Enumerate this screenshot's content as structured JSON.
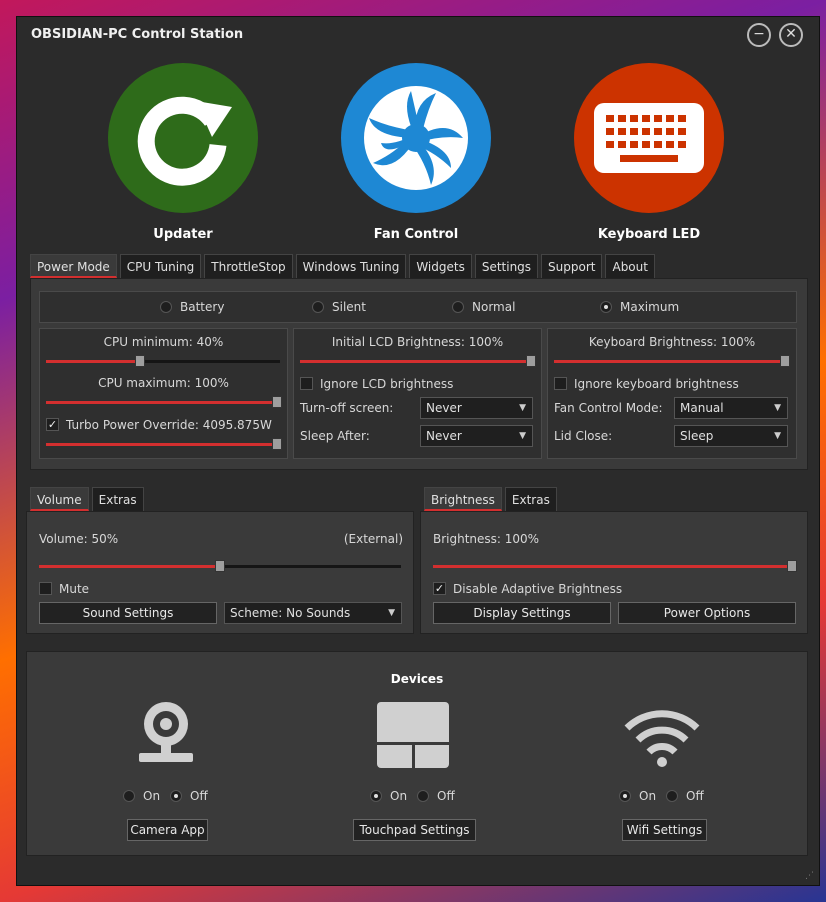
{
  "window": {
    "title": "OBSIDIAN-PC Control Station",
    "minimize": "−",
    "close": "✕"
  },
  "apps": [
    {
      "label": "Updater",
      "icon": "refresh-icon",
      "color": "#2e6b1a"
    },
    {
      "label": "Fan Control",
      "icon": "fan-icon",
      "color": "#1e88d4"
    },
    {
      "label": "Keyboard LED",
      "icon": "keyboard-icon",
      "color": "#cc3300"
    }
  ],
  "main_tabs": [
    "Power Mode",
    "CPU Tuning",
    "ThrottleStop",
    "Windows Tuning",
    "Widgets",
    "Settings",
    "Support",
    "About"
  ],
  "power_modes": [
    {
      "label": "Battery",
      "selected": false
    },
    {
      "label": "Silent",
      "selected": false
    },
    {
      "label": "Normal",
      "selected": false
    },
    {
      "label": "Maximum",
      "selected": true
    }
  ],
  "cpu": {
    "min_label": "CPU minimum: 40%",
    "min_value": 40,
    "max_label": "CPU maximum: 100%",
    "max_value": 100,
    "turbo_label": "Turbo Power Override: 4095.875W",
    "turbo_checked": true,
    "turbo_value": 100
  },
  "lcd": {
    "label": "Initial LCD Brightness: 100%",
    "value": 100,
    "ignore_label": "Ignore LCD brightness",
    "ignore_checked": false,
    "turnoff_label": "Turn-off screen:",
    "turnoff_value": "Never",
    "sleep_label": "Sleep After:",
    "sleep_value": "Never"
  },
  "keyboard": {
    "label": "Keyboard Brightness: 100%",
    "value": 100,
    "ignore_label": "Ignore keyboard brightness",
    "ignore_checked": false,
    "fan_label": "Fan Control Mode:",
    "fan_value": "Manual",
    "lid_label": "Lid Close:",
    "lid_value": "Sleep"
  },
  "volume_tabs": [
    "Volume",
    "Extras"
  ],
  "volume": {
    "label": "Volume: 50%",
    "value": 50,
    "external": "(External)",
    "mute_label": "Mute",
    "mute_checked": false,
    "sound_settings": "Sound Settings",
    "scheme": "Scheme: No Sounds"
  },
  "brightness_tabs": [
    "Brightness",
    "Extras"
  ],
  "brightness": {
    "label": "Brightness: 100%",
    "value": 100,
    "adaptive_label": "Disable Adaptive Brightness",
    "adaptive_checked": true,
    "display_settings": "Display Settings",
    "power_options": "Power Options"
  },
  "devices": {
    "title": "Devices",
    "on": "On",
    "off": "Off",
    "camera": {
      "icon": "webcam-icon",
      "state": "off",
      "button": "Camera App"
    },
    "touchpad": {
      "icon": "touchpad-icon",
      "state": "on",
      "button": "Touchpad Settings"
    },
    "wifi": {
      "icon": "wifi-icon",
      "state": "on",
      "button": "Wifi Settings"
    }
  },
  "colors": {
    "accent": "#d32f2f",
    "window_bg": "#2b2b2b",
    "panel_bg": "#3a3a3a"
  }
}
